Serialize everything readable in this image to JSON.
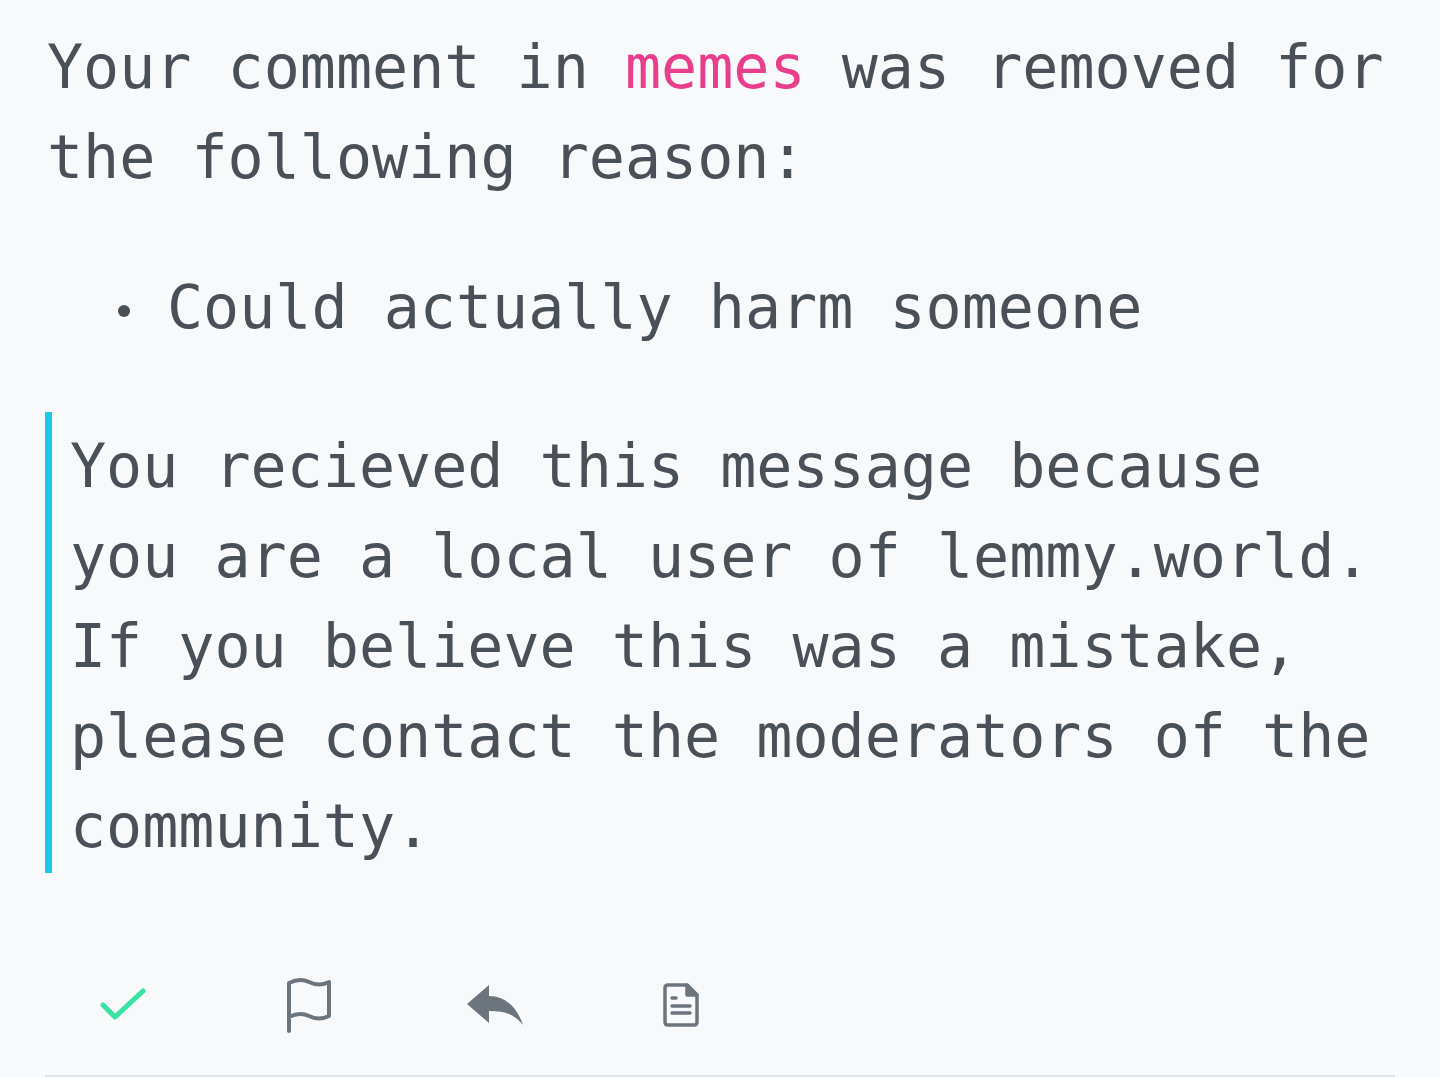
{
  "message": {
    "intro_before": "Your comment in",
    "community": "memes",
    "intro_after": "was removed for the following reason:",
    "reasons": [
      "Could actually harm someone"
    ],
    "note": "You recieved this message because you are a local user of lemmy.world. If you believe this was a mistake, please contact the moderators of the community.",
    "read": true
  },
  "actions": [
    {
      "kind": "read"
    },
    {
      "kind": "report"
    },
    {
      "kind": "reply"
    },
    {
      "kind": "source"
    }
  ]
}
